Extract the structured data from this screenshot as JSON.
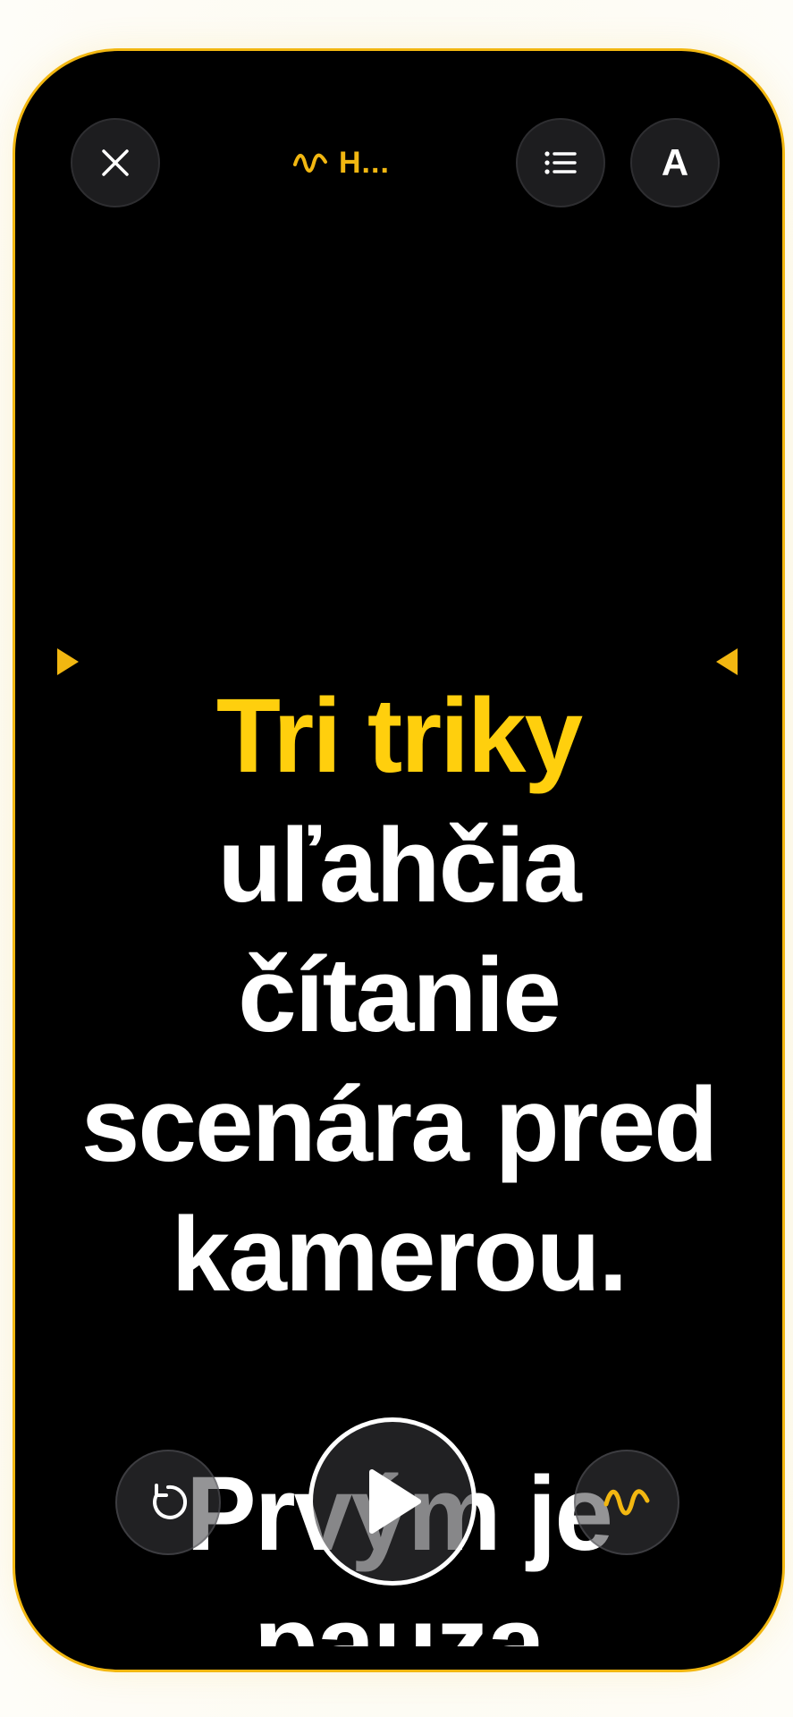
{
  "header": {
    "title": "H...",
    "close_icon": "close-icon",
    "list_icon": "list-icon",
    "font_button_label": "A",
    "wave_icon": "waveform-icon"
  },
  "script": {
    "lines": [
      "Tri triky",
      "uľahčia",
      "čítanie",
      "scenára pred",
      "kamerou.",
      "",
      "Prvým je",
      "pauza"
    ],
    "active_line_count": 1
  },
  "controls": {
    "restart_icon": "restart-icon",
    "play_icon": "play-icon",
    "voice_icon": "waveform-icon"
  },
  "colors": {
    "accent": "#f2b711",
    "highlight": "#ffcf0d",
    "background": "#000000",
    "text": "#ffffff"
  }
}
